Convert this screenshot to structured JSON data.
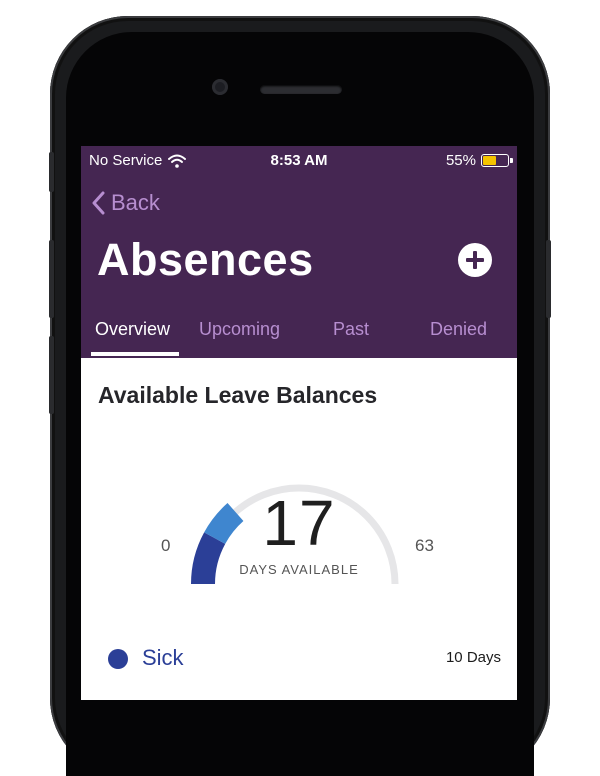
{
  "status_bar": {
    "carrier": "No Service",
    "time": "8:53 AM",
    "battery_percent": "55%",
    "battery_level": 0.55
  },
  "nav": {
    "back_label": "Back"
  },
  "page": {
    "title": "Absences"
  },
  "tabs": [
    {
      "label": "Overview",
      "active": true
    },
    {
      "label": "Upcoming",
      "active": false
    },
    {
      "label": "Past",
      "active": false
    },
    {
      "label": "Denied",
      "active": false
    }
  ],
  "balances": {
    "section_title": "Available Leave Balances",
    "gauge": {
      "min_label": "0",
      "max_label": "63",
      "value_label": "17",
      "caption": "DAYS AVAILABLE",
      "min": 0,
      "max": 63,
      "value": 17,
      "segments": [
        {
          "name": "Sick",
          "value": 10,
          "color": "#2b3f97"
        },
        {
          "value": 7,
          "color": "#3f86cf"
        }
      ],
      "track_color": "#e6e6e8"
    },
    "leave_types": [
      {
        "name": "Sick",
        "days": "10 Days",
        "color": "#2b3f97"
      }
    ]
  },
  "colors": {
    "header_bg": "#452652",
    "tab_inactive": "#b78ed0",
    "back_link": "#b78ed0"
  }
}
